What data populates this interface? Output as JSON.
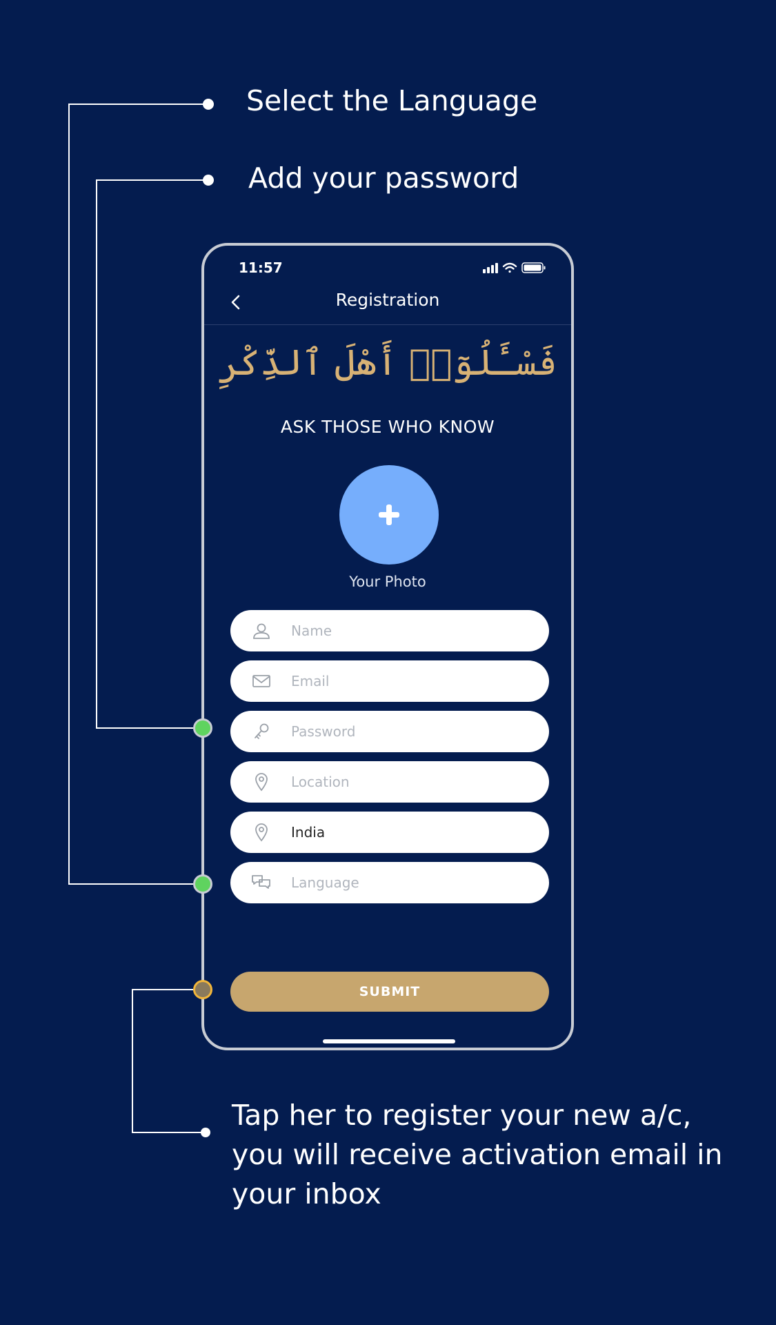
{
  "callouts": {
    "language": "Select the Language",
    "password": "Add your password",
    "submit": "Tap her to register your new a/c, you will receive activation email in your inbox"
  },
  "status_bar": {
    "time": "11:57"
  },
  "nav": {
    "title": "Registration"
  },
  "header": {
    "arabic": "فَسْـَٔلُوٓا۟ أَهْلَ ٱلذِّكْرِ",
    "tagline": "ASK THOSE WHO KNOW"
  },
  "photo": {
    "label": "Your Photo"
  },
  "form": {
    "name": {
      "placeholder": "Name",
      "value": "",
      "icon": "person-icon"
    },
    "email": {
      "placeholder": "Email",
      "value": "",
      "icon": "mail-icon"
    },
    "password": {
      "placeholder": "Password",
      "value": "",
      "icon": "key-icon"
    },
    "location": {
      "placeholder": "Location",
      "value": "",
      "icon": "location-pin-icon"
    },
    "country": {
      "placeholder": "",
      "value": "India",
      "icon": "location-pin-icon"
    },
    "language": {
      "placeholder": "Language",
      "value": "",
      "icon": "chat-bubbles-icon"
    }
  },
  "submit": {
    "label": "SUBMIT"
  },
  "colors": {
    "background": "#041c4f",
    "accent_gold": "#c7a66e",
    "arabic_gold": "#d8b275",
    "photo_blue": "#76aefc",
    "marker_green": "#5fd35f",
    "marker_orange": "#f2b63a"
  }
}
